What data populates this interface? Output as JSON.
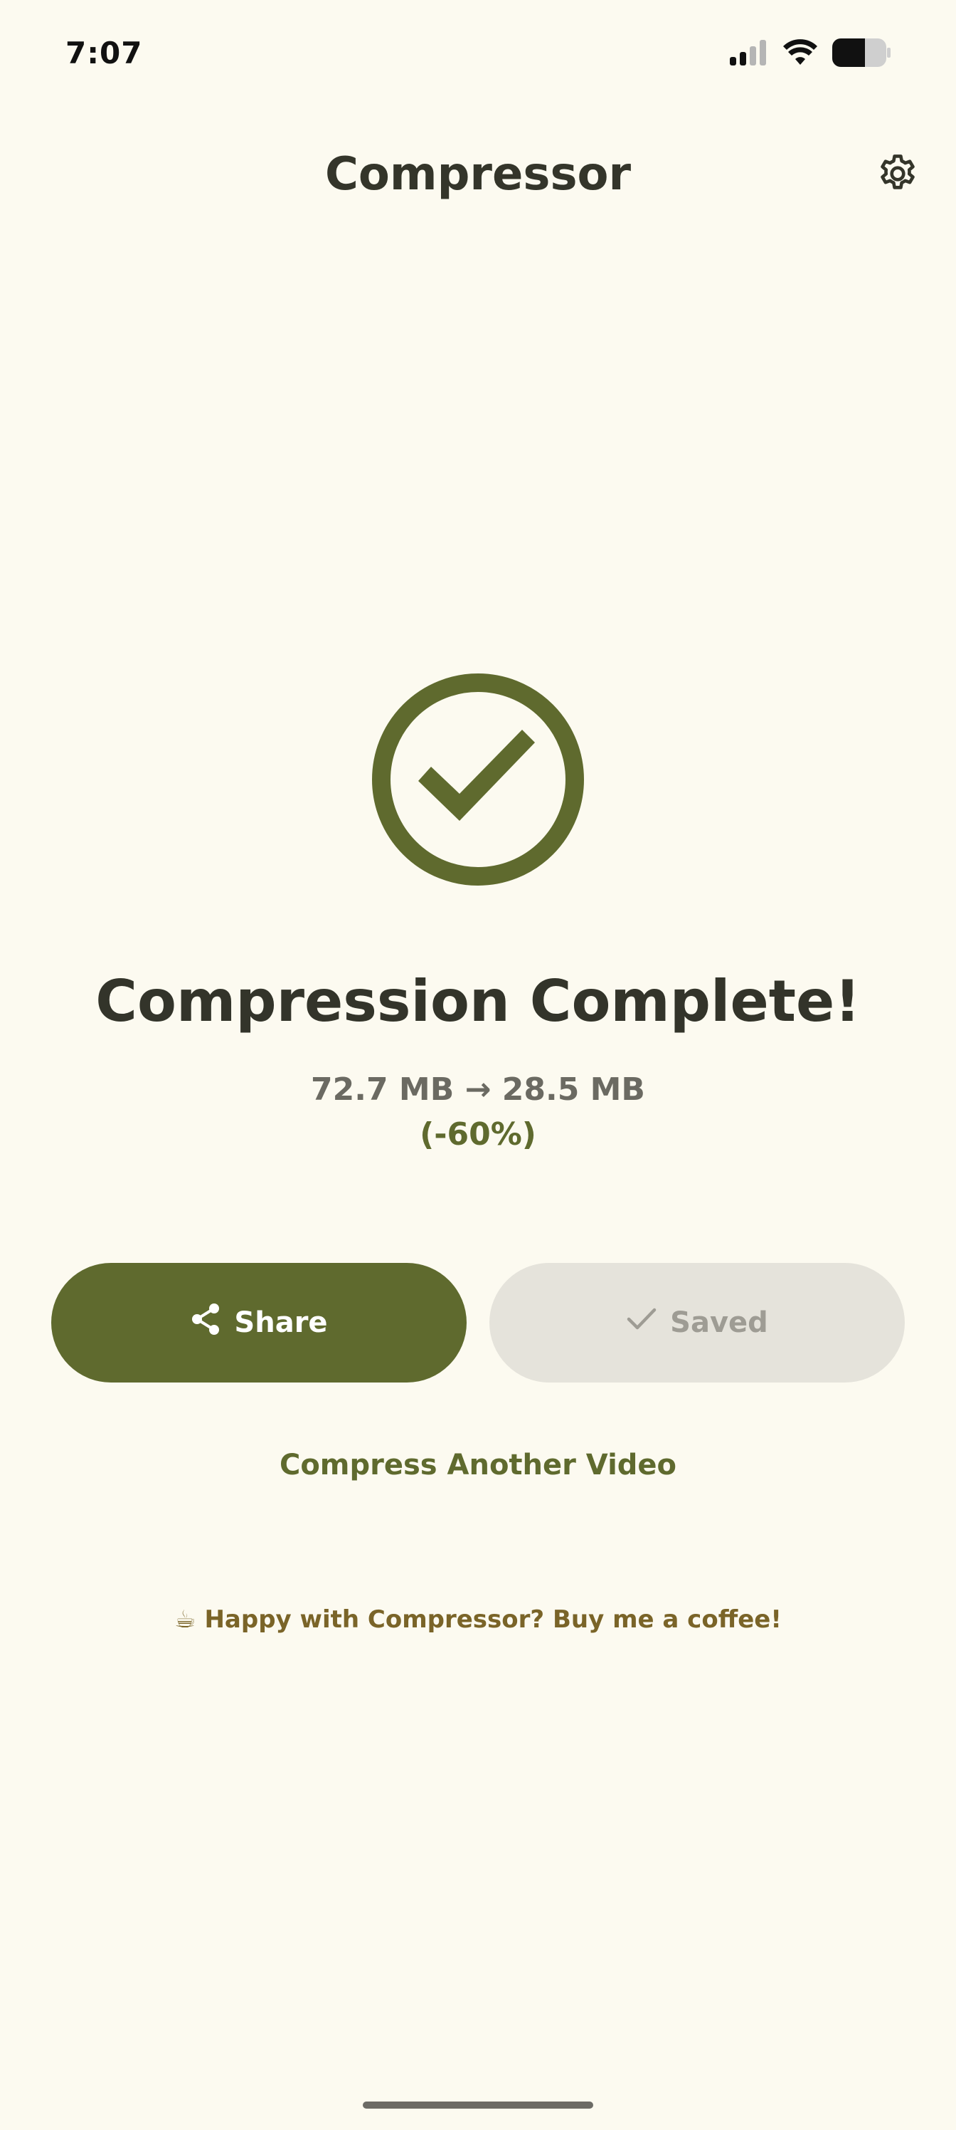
{
  "status_bar": {
    "time": "7:07",
    "icons": [
      "signal-icon",
      "wifi-icon",
      "battery-icon"
    ]
  },
  "app_bar": {
    "title": "Compressor",
    "settings_icon": "gear-icon"
  },
  "result": {
    "icon": "check-circle-icon",
    "headline": "Compression Complete!",
    "size_summary": "72.7 MB → 28.5 MB",
    "reduction": "(-60%)"
  },
  "actions": {
    "share_label": "Share",
    "share_icon": "share-icon",
    "saved_label": "Saved",
    "saved_icon": "check-icon",
    "compress_another_label": "Compress Another Video"
  },
  "footer": {
    "coffee_text": "☕ Happy with Compressor? Buy me a coffee!"
  },
  "colors": {
    "background": "#fcfaf0",
    "accent": "#5f6a2e",
    "saved_button_bg": "#e5e3db",
    "saved_button_text": "#9e9c94",
    "title_text": "#34352a",
    "coffee_text": "#7a6428"
  }
}
